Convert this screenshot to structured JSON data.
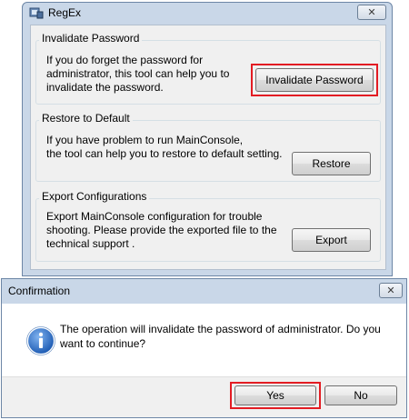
{
  "main_window": {
    "title": "RegEx",
    "close_glyph": "✕"
  },
  "groups": [
    {
      "title": "Invalidate Password",
      "lines": [
        "If you do forget the password for",
        "administrator, this tool can help you  to",
        "invalidate the password."
      ],
      "button": "Invalidate Password"
    },
    {
      "title": "Restore to Default",
      "lines": [
        "If you have problem to run MainConsole,",
        "the tool can help you to restore to default setting."
      ],
      "button": "Restore"
    },
    {
      "title": "Export Configurations",
      "lines": [
        "Export MainConsole configuration for trouble",
        "shooting. Please provide the exported file to the",
        "technical support ."
      ],
      "button": "Export"
    }
  ],
  "confirm_dialog": {
    "title": "Confirmation",
    "close_glyph": "✕",
    "icon": "info-icon",
    "message_lines": [
      "The operation will invalidate the password of administrator. Do you",
      "want to continue?"
    ],
    "yes_label": "Yes",
    "no_label": "No"
  },
  "colors": {
    "highlight_red": "#e31c23",
    "info_blue": "#2b6fc6"
  }
}
